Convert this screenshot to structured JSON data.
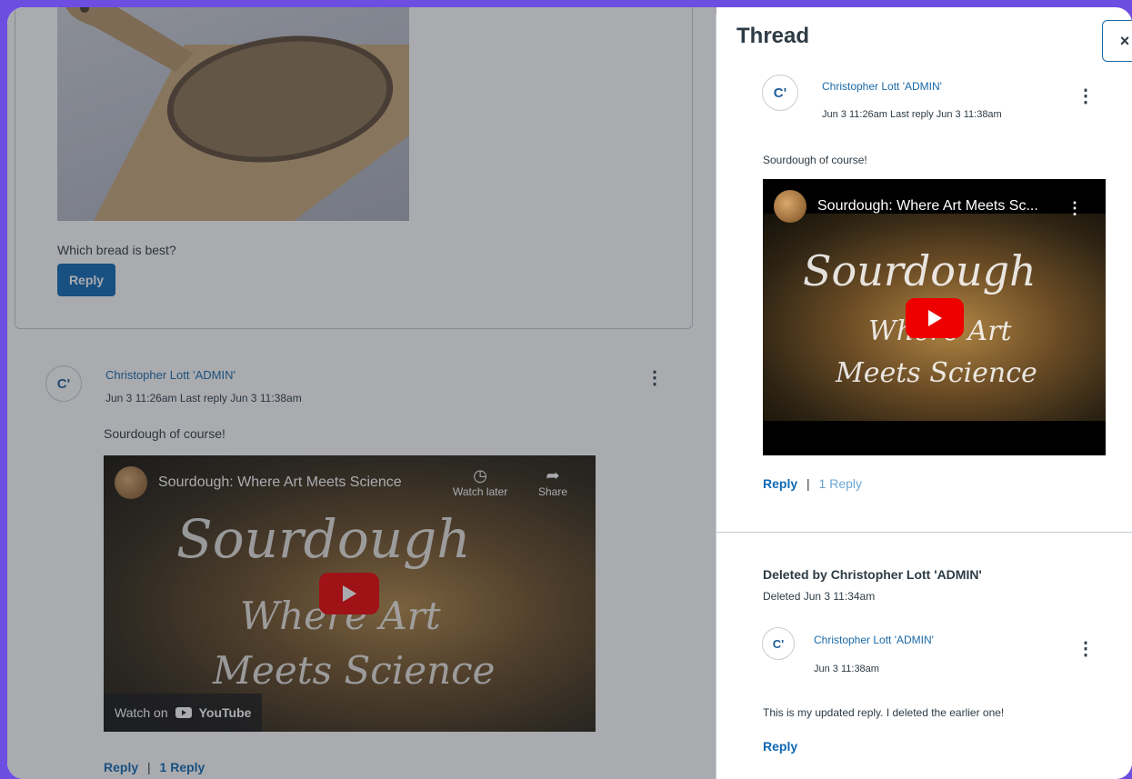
{
  "main": {
    "question": "Which bread is best?",
    "reply_button": "Reply",
    "entry": {
      "avatar": "C'",
      "author": "Christopher Lott 'ADMIN'",
      "meta": "Jun 3 11:26am  Last reply Jun 3 11:38am",
      "text": "Sourdough of course!",
      "video": {
        "title": "Sourdough: Where Art Meets Science",
        "big_line1": "Sourdough",
        "big_line2": "Where Art",
        "big_line3": "Meets Science",
        "watch_later": "Watch later",
        "share": "Share",
        "watch_on": "Watch on",
        "youtube": "YouTube"
      },
      "reply_link": "Reply",
      "separator": "|",
      "replies_link": "1 Reply"
    }
  },
  "thread": {
    "title": "Thread",
    "close": "×",
    "entry": {
      "avatar": "C'",
      "author": "Christopher Lott 'ADMIN'",
      "meta": "Jun 3 11:26am  Last reply Jun 3 11:38am",
      "text": "Sourdough of course!",
      "video_title": "Sourdough: Where Art Meets Sc...",
      "big_line1": "Sourdough",
      "big_line2": "Where Art",
      "big_line3": "Meets Science",
      "reply_link": "Reply",
      "separator": "|",
      "replies_link": "1 Reply"
    },
    "deleted": {
      "title": "Deleted by Christopher Lott 'ADMIN'",
      "meta": "Deleted Jun 3 11:34am"
    },
    "reply": {
      "avatar": "C'",
      "author": "Christopher Lott 'ADMIN'",
      "meta": "Jun 3 11:38am",
      "text": "This is my updated reply. I deleted the earlier one!",
      "reply_link": "Reply"
    }
  },
  "colors": {
    "brand_blue": "#0e68b3",
    "link_blue": "#1a6aa8",
    "background_purple": "#6d4ee0",
    "youtube_red": "#ee0000"
  }
}
